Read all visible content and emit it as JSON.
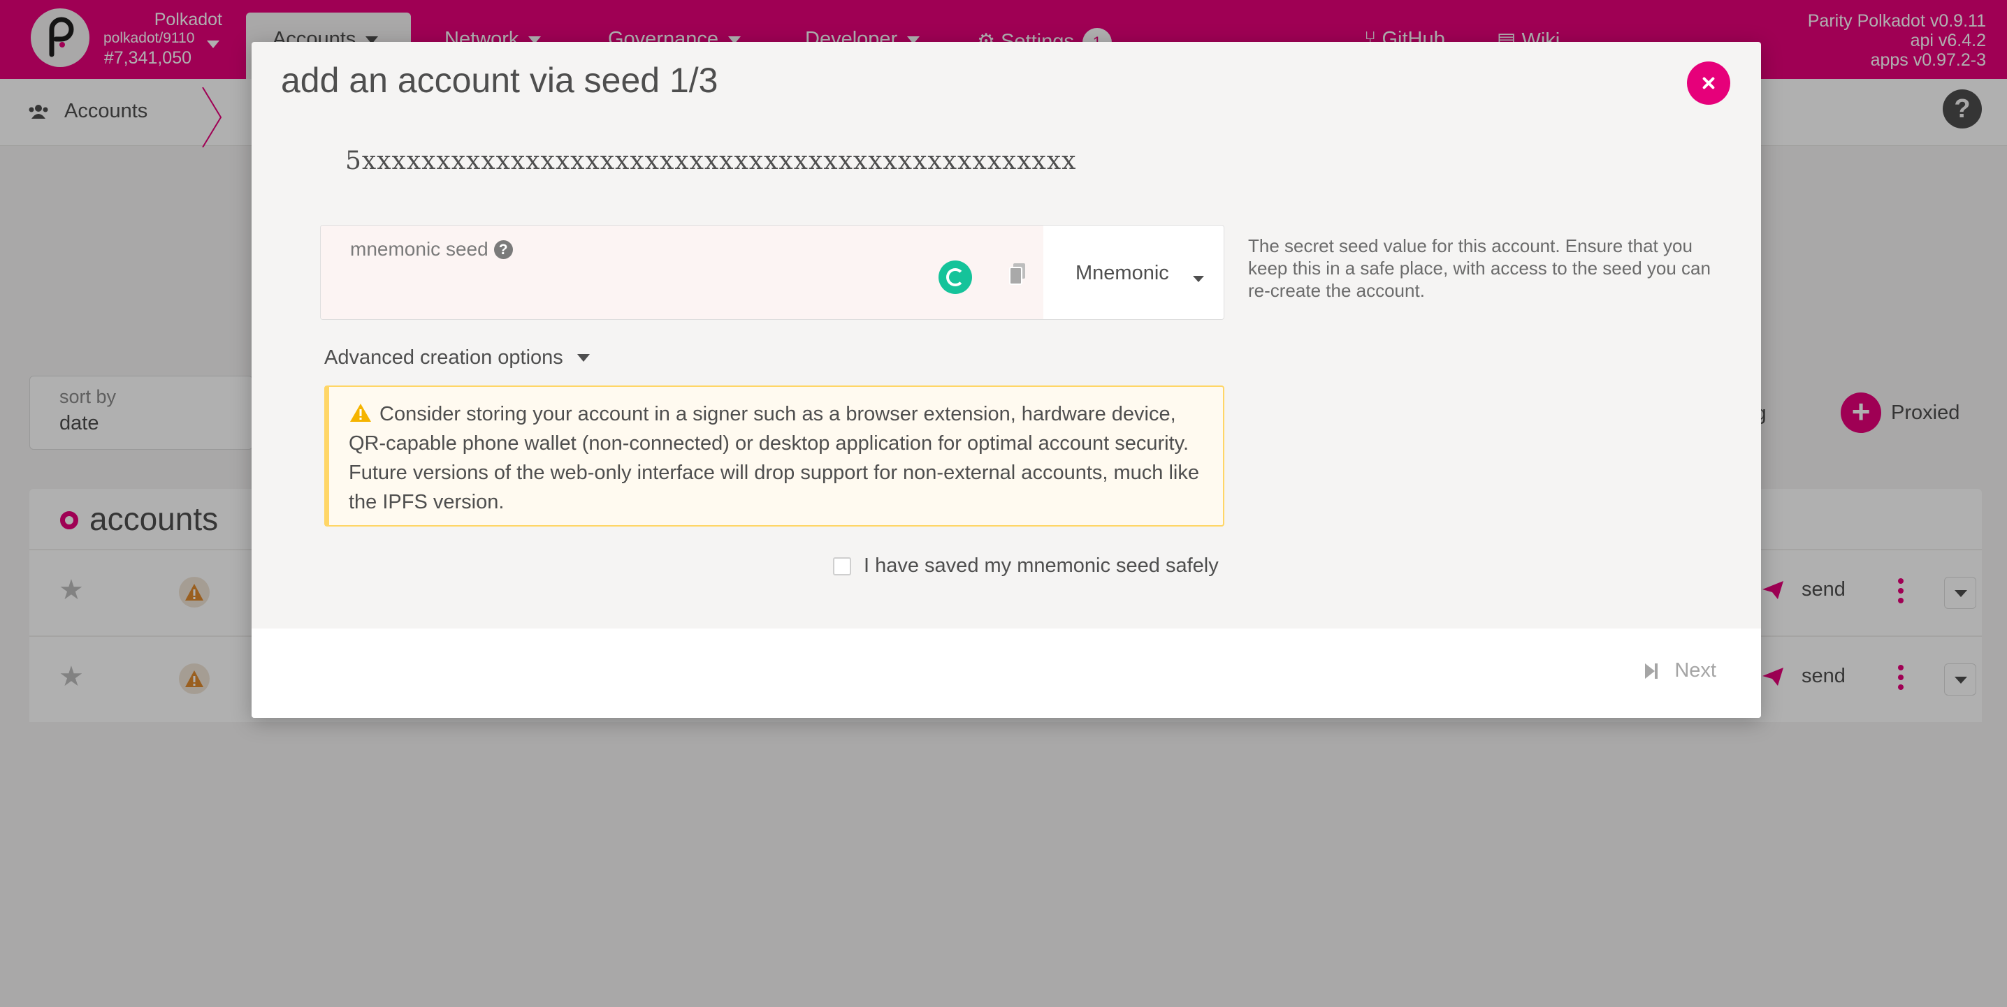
{
  "app": {
    "chain_name": "Polkadot",
    "node": "polkadot/9110",
    "block": "#7,341,050",
    "versions": [
      "Parity Polkadot v0.9.11",
      "api v6.4.2",
      "apps v0.97.2-3"
    ]
  },
  "nav": {
    "tabs": [
      {
        "label": "Accounts"
      },
      {
        "label": "Network"
      },
      {
        "label": "Governance"
      },
      {
        "label": "Developer"
      },
      {
        "label": "Settings",
        "badge": "1"
      }
    ],
    "links": [
      {
        "label": "GitHub"
      },
      {
        "label": "Wiki"
      }
    ]
  },
  "subnav": {
    "accounts_label": "Accounts"
  },
  "page": {
    "sort_label": "sort by",
    "sort_value": "date",
    "multisig_label": "tisig",
    "proxied_label": "Proxied",
    "accounts_title": "accounts",
    "send_label": "send"
  },
  "modal": {
    "title": "add an account via seed 1/3",
    "address": "5xxxxxxxxxxxxxxxxxxxxxxxxxxxxxxxxxxxxxxxxxxxxxxxx",
    "seed_label": "mnemonic seed",
    "seed_type": "Mnemonic",
    "seed_help": "The secret seed value for this account. Ensure that you keep this in a safe place, with access to the seed you can re-create the account.",
    "advanced_label": "Advanced creation options",
    "warning": "Consider storing your account in a signer such as a browser extension, hardware device, QR-capable phone wallet (non-connected) or desktop application for optimal account security. Future versions of the web-only interface will drop support for non-external accounts, much like the IPFS version.",
    "saved_label": "I have saved my mnemonic seed safely",
    "next_label": "Next"
  },
  "colors": {
    "accent": "#e6007a",
    "background": "#f5f4f3",
    "warning_bg": "#fffaf0",
    "warning_border": "#ffd666",
    "grammarly": "#15c39a"
  }
}
